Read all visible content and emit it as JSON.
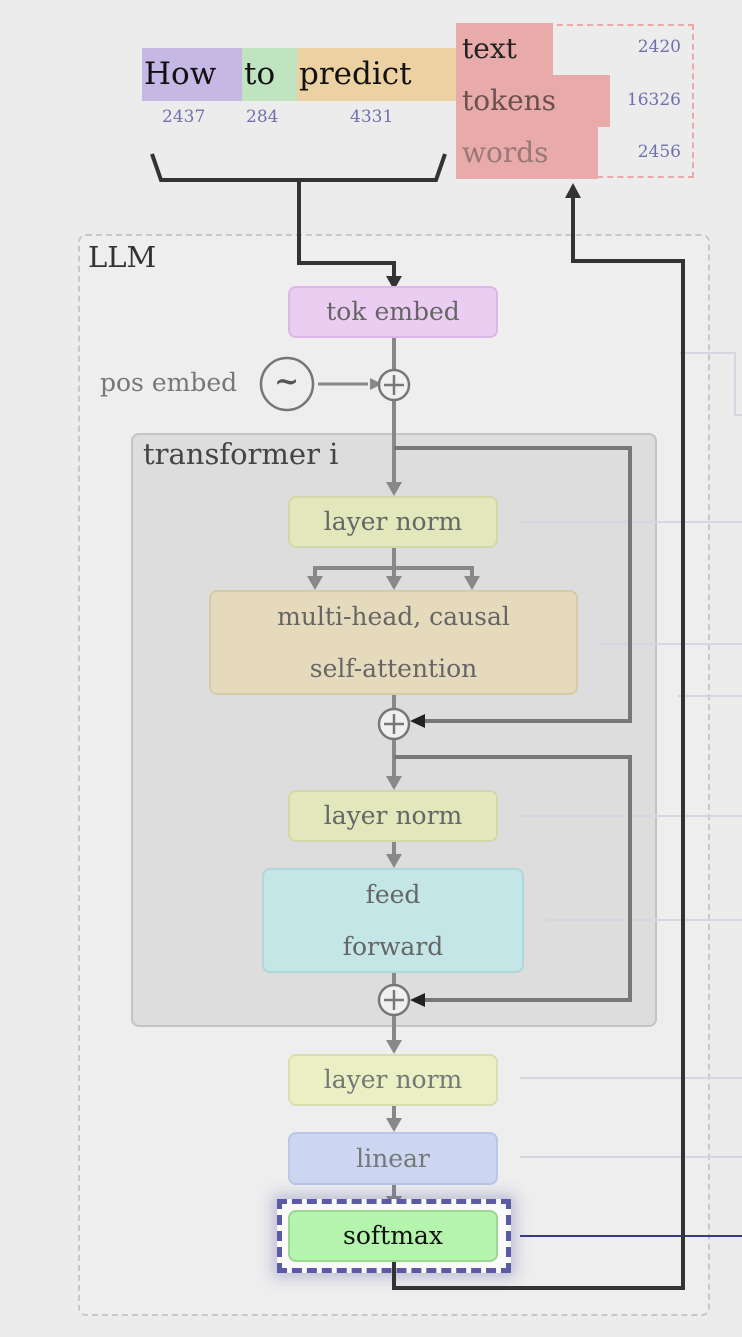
{
  "input_tokens": [
    {
      "text": "How",
      "id": "2437",
      "color": "#c5b8e4"
    },
    {
      "text": "to",
      "id": "284",
      "color": "#c0e4c0"
    },
    {
      "text": "predict",
      "id": "4331",
      "color": "#ecd2a2"
    }
  ],
  "output_candidates": [
    {
      "text": "text",
      "id": "2420",
      "probability_bar": 0.35
    },
    {
      "text": "tokens",
      "id": "16326",
      "probability_bar": 0.65
    },
    {
      "text": "words",
      "id": "2456",
      "probability_bar": 0.58
    }
  ],
  "llm": {
    "label": "LLM",
    "tok_embed": "tok embed",
    "pos_embed": "pos embed",
    "pos_embed_symbol": "~",
    "add_symbol": "+",
    "transformer": {
      "label": "transformer i",
      "layer_norm_1": "layer norm",
      "attention_line1": "multi-head, causal",
      "attention_line2": "self-attention",
      "layer_norm_2": "layer norm",
      "ffn_line1": "feed",
      "ffn_line2": "forward"
    },
    "final_layer_norm": "layer norm",
    "linear": "linear",
    "softmax": "softmax"
  },
  "colors": {
    "tok_embed": "#ebcdf2",
    "layer_norm": "#e2e8bc",
    "attention": "#e5dabc",
    "ffn": "#c4e6e6",
    "linear": "#cdd6f0",
    "softmax": "#b4f4ac",
    "highlight": "#5a5aa5",
    "output_box": "#e9aaaa",
    "number_text": "#7070b0"
  }
}
